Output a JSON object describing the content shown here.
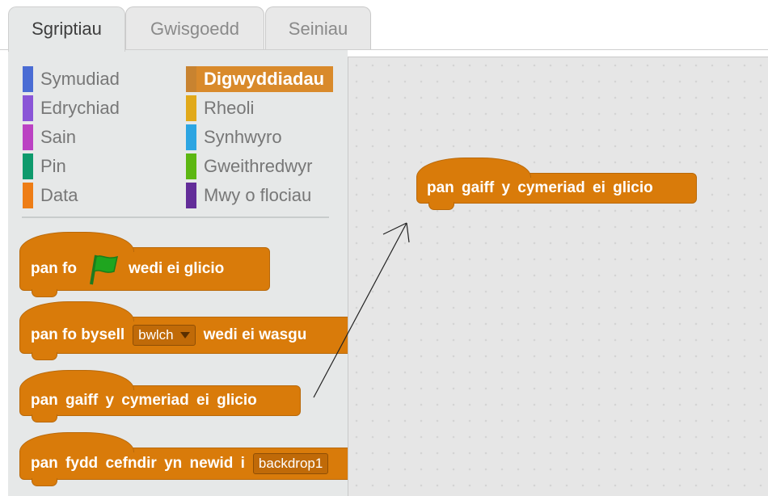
{
  "tabs": [
    {
      "label": "Sgriptiau"
    },
    {
      "label": "Gwisgoedd"
    },
    {
      "label": "Seiniau"
    }
  ],
  "categories": {
    "left": [
      {
        "label": "Symudiad",
        "color": "#4a6cd4"
      },
      {
        "label": "Edrychiad",
        "color": "#8a55d7"
      },
      {
        "label": "Sain",
        "color": "#bb42c3"
      },
      {
        "label": "Pin",
        "color": "#0e9a6c"
      },
      {
        "label": "Data",
        "color": "#ee7d16"
      }
    ],
    "right": [
      {
        "label": "Digwyddiadau",
        "color": "#c88330"
      },
      {
        "label": "Rheoli",
        "color": "#e1a91a"
      },
      {
        "label": "Synhwyro",
        "color": "#2ca5e2"
      },
      {
        "label": "Gweithredwyr",
        "color": "#5cb712"
      },
      {
        "label": "Mwy o flociau",
        "color": "#632d99"
      }
    ],
    "selected": "Digwyddiadau"
  },
  "blocks": {
    "flag_clicked": {
      "before": "pan fo",
      "icon": "green-flag-icon",
      "after": "wedi ei glicio"
    },
    "key_pressed": {
      "w1": "pan fo bysell",
      "dropdown": "bwlch",
      "w2": "wedi ei wasgu"
    },
    "sprite_clicked": {
      "text": "pan gaiff y cymeriad ei glicio"
    },
    "backdrop_switch": {
      "text": "pan fydd cefndir yn newid i",
      "dropdown": "backdrop1"
    }
  },
  "script": {
    "block": {
      "text": "pan gaiff y cymeriad ei glicio"
    }
  },
  "colors": {
    "events": "#d97b0a",
    "palette_bg": "#e6e8e8",
    "script_bg": "#e6e6e6"
  }
}
